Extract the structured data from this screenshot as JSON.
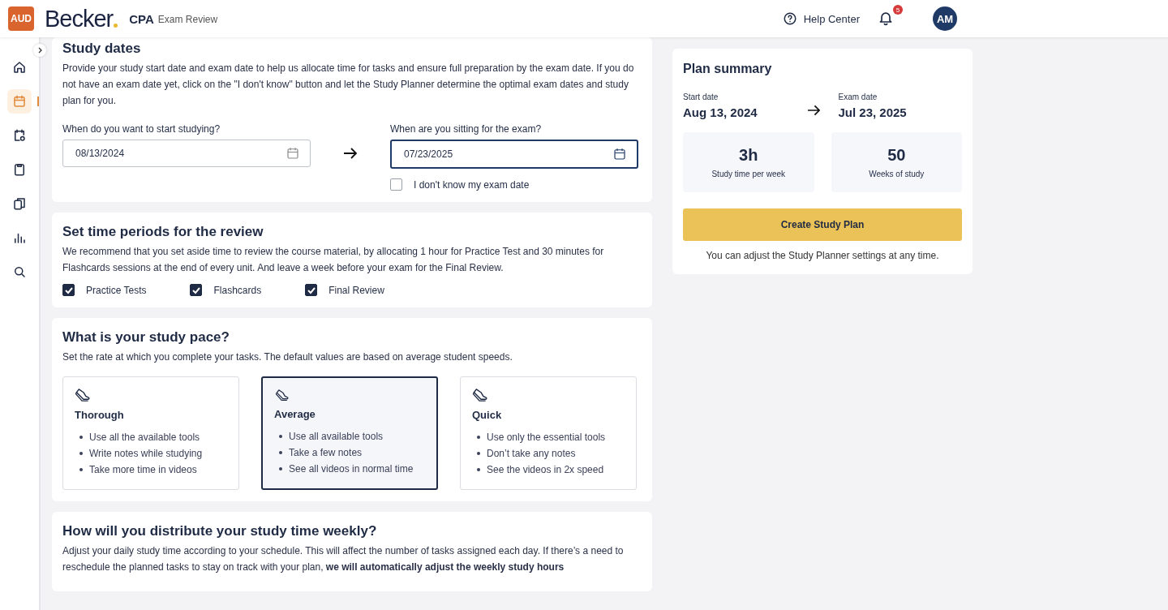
{
  "header": {
    "badge": "AUD",
    "logo": "Becker",
    "product": "CPA",
    "product_sub": "Exam Review",
    "help": "Help Center",
    "notifications": "5",
    "avatar": "AM"
  },
  "sidebar": {
    "items": [
      {
        "kind": "home",
        "selected": false
      },
      {
        "kind": "calendar",
        "selected": true
      },
      {
        "kind": "tasks",
        "selected": false
      },
      {
        "kind": "clipboard",
        "selected": false
      },
      {
        "kind": "cards",
        "selected": false
      },
      {
        "kind": "chart",
        "selected": false
      },
      {
        "kind": "search",
        "selected": false
      }
    ]
  },
  "study_dates": {
    "title": "Study dates",
    "description": "Provide your study start date and exam date to help us allocate time for tasks and ensure full preparation by the exam date. If you do not have an exam date yet, click on the \"I don't know\" button and let the Study Planner determine the optimal exam dates and study plan for you.",
    "start": {
      "label": "When do you want to start studying?",
      "value": "08/13/2024",
      "focused": false
    },
    "exam": {
      "label": "When are you sitting for the exam?",
      "value": "07/23/2025",
      "focused": true
    },
    "unknown": {
      "label": "I don't know my exam date",
      "checked": false
    }
  },
  "review": {
    "title": "Set time periods for the review",
    "description": "We recommend that you set aside time to review the course material, by allocating 1 hour for Practice Test and 30 minutes for Flashcards sessions at the end of every unit. And leave a week before your exam for the Final Review.",
    "options": [
      {
        "label": "Practice Tests",
        "checked": true
      },
      {
        "label": "Flashcards",
        "checked": true
      },
      {
        "label": "Final Review",
        "checked": true
      }
    ]
  },
  "pace": {
    "title": "What is your study pace?",
    "description": "Set the rate at which you complete your tasks. The default values are based on average student speeds.",
    "options": [
      {
        "title": "Thorough",
        "selected": false,
        "points": [
          "Use all the available tools",
          "Write notes while studying",
          "Take more time in videos"
        ]
      },
      {
        "title": "Average",
        "selected": true,
        "points": [
          "Use all available tools",
          "Take a few notes",
          "See all videos in normal time"
        ]
      },
      {
        "title": "Quick",
        "selected": false,
        "points": [
          "Use only the essential tools",
          "Don’t take any notes",
          "See the videos in 2x speed"
        ]
      }
    ]
  },
  "distribute": {
    "title": "How will you distribute your study time weekly?",
    "description": "Adjust your daily study time according to your schedule. This will affect the number of tasks assigned each day. If there’s a need to reschedule the planned tasks to stay on track with your plan, **we will automatically adjust the weekly study hours**"
  },
  "summary": {
    "title": "Plan summary",
    "start_label": "Start date",
    "start_value": "Aug 13, 2024",
    "exam_label": "Exam date",
    "exam_value": "Jul 23, 2025",
    "stats": [
      {
        "value": "3h",
        "label": "Study time per week"
      },
      {
        "value": "50",
        "label": "Weeks of study"
      }
    ],
    "button": "Create Study Plan",
    "note": "You can adjust the Study Planner settings at any time."
  }
}
